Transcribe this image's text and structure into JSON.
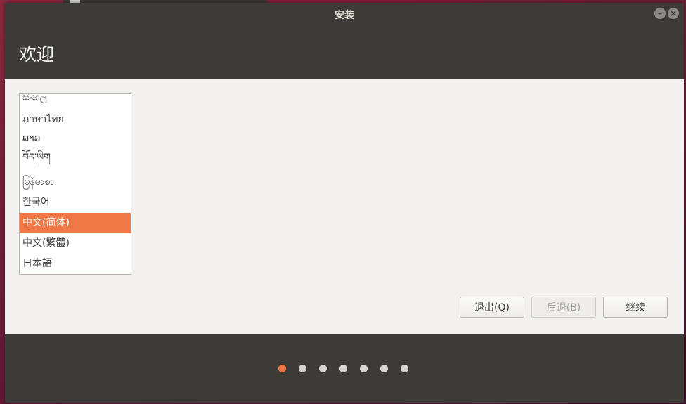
{
  "window": {
    "title": "安装"
  },
  "header": {
    "title": "欢迎"
  },
  "language_list": {
    "items": [
      {
        "label": "සිංහල",
        "selected": false
      },
      {
        "label": "ภาษาไทย",
        "selected": false
      },
      {
        "label": "ລາວ",
        "selected": false
      },
      {
        "label": "བོད་ཡིག",
        "selected": false
      },
      {
        "label": "မြန်မာစာ",
        "selected": false
      },
      {
        "label": "한국어",
        "selected": false
      },
      {
        "label": "中文(简体)",
        "selected": true
      },
      {
        "label": "中文(繁體)",
        "selected": false
      },
      {
        "label": "日本語",
        "selected": false
      }
    ]
  },
  "buttons": {
    "quit_label": "退出(Q)",
    "back_label": "后退(B)",
    "continue_label": "继续"
  },
  "progress": {
    "total_steps": 7,
    "current_step": 1
  },
  "colors": {
    "accent": "#f07746",
    "header_bg": "#3c3b37",
    "content_bg": "#f2f1f0"
  },
  "icons": {
    "minimize": "minimize-icon",
    "close": "close-icon"
  }
}
